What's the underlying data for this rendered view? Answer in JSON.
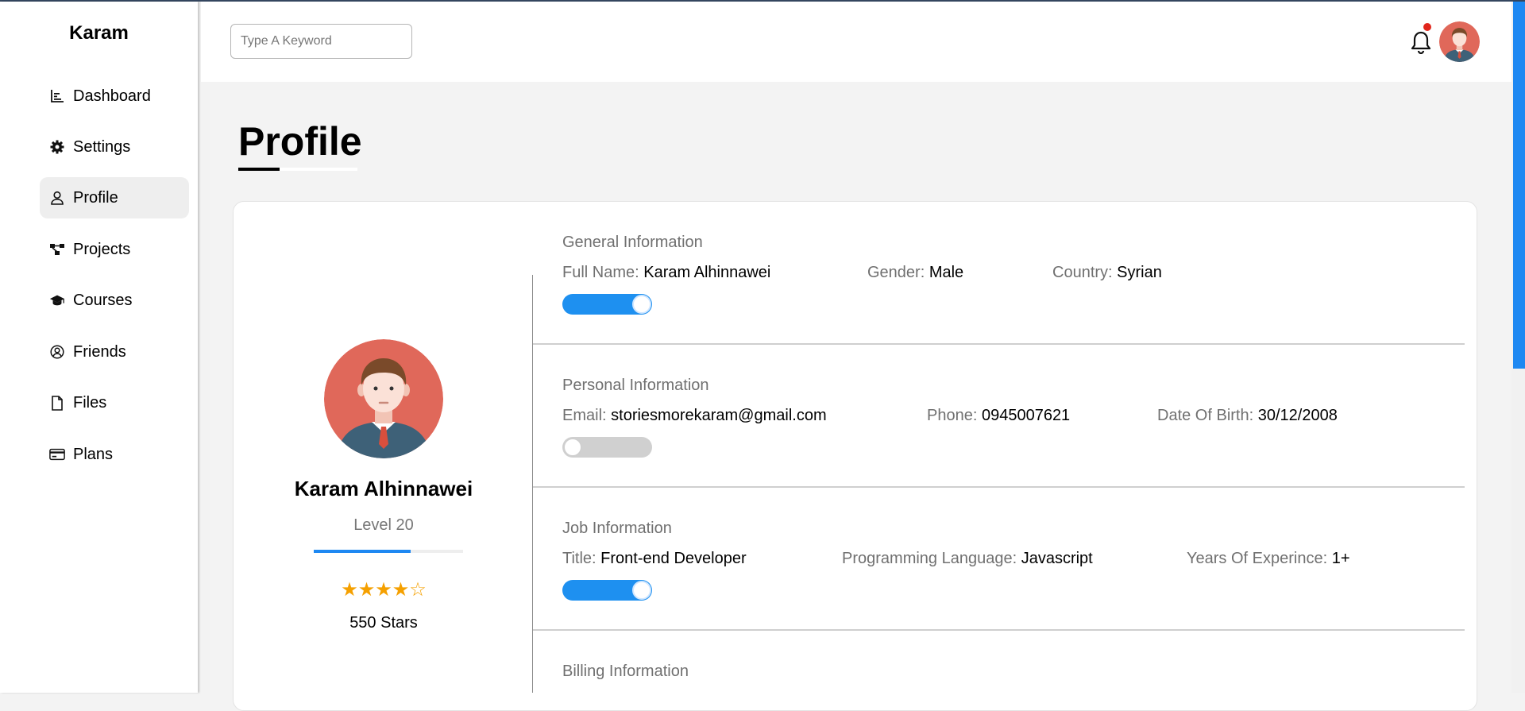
{
  "sidebar": {
    "brand": "Karam",
    "items": [
      {
        "label": "Dashboard",
        "icon": "chart-icon"
      },
      {
        "label": "Settings",
        "icon": "gear-icon"
      },
      {
        "label": "Profile",
        "icon": "user-icon",
        "active": true
      },
      {
        "label": "Projects",
        "icon": "diagram-icon"
      },
      {
        "label": "Courses",
        "icon": "graduation-cap-icon"
      },
      {
        "label": "Friends",
        "icon": "user-circle-icon"
      },
      {
        "label": "Files",
        "icon": "file-icon"
      },
      {
        "label": "Plans",
        "icon": "credit-card-icon"
      }
    ]
  },
  "header": {
    "search_placeholder": "Type A Keyword",
    "has_notification": true
  },
  "page": {
    "title": "Profile"
  },
  "profile": {
    "name": "Karam Alhinnawei",
    "level": "Level 20",
    "level_progress": 0.65,
    "rating": 4,
    "rating_max": 5,
    "stars_glyphs": "★★★★☆",
    "stars_text": "550 Stars"
  },
  "sections": {
    "general": {
      "title": "General Information",
      "full_name_label": "Full Name:",
      "full_name": "Karam Alhinnawei",
      "gender_label": "Gender:",
      "gender": "Male",
      "country_label": "Country:",
      "country": "Syrian",
      "toggle_on": true
    },
    "personal": {
      "title": "Personal Information",
      "email_label": "Email:",
      "email": "storiesmorekaram@gmail.com",
      "phone_label": "Phone:",
      "phone": "0945007621",
      "dob_label": "Date Of Birth:",
      "dob": "30/12/2008",
      "toggle_on": false
    },
    "job": {
      "title": "Job Information",
      "title_label": "Title:",
      "title_value": "Front-end Developer",
      "language_label": "Programming Language:",
      "language": "Javascript",
      "years_label": "Years Of Experince:",
      "years": "1+",
      "toggle_on": true
    },
    "billing": {
      "title": "Billing Information"
    }
  },
  "colors": {
    "accent": "#1e88f2",
    "star": "#f5a000",
    "notification": "#e1261c",
    "avatar_bg": "#e0685a"
  }
}
